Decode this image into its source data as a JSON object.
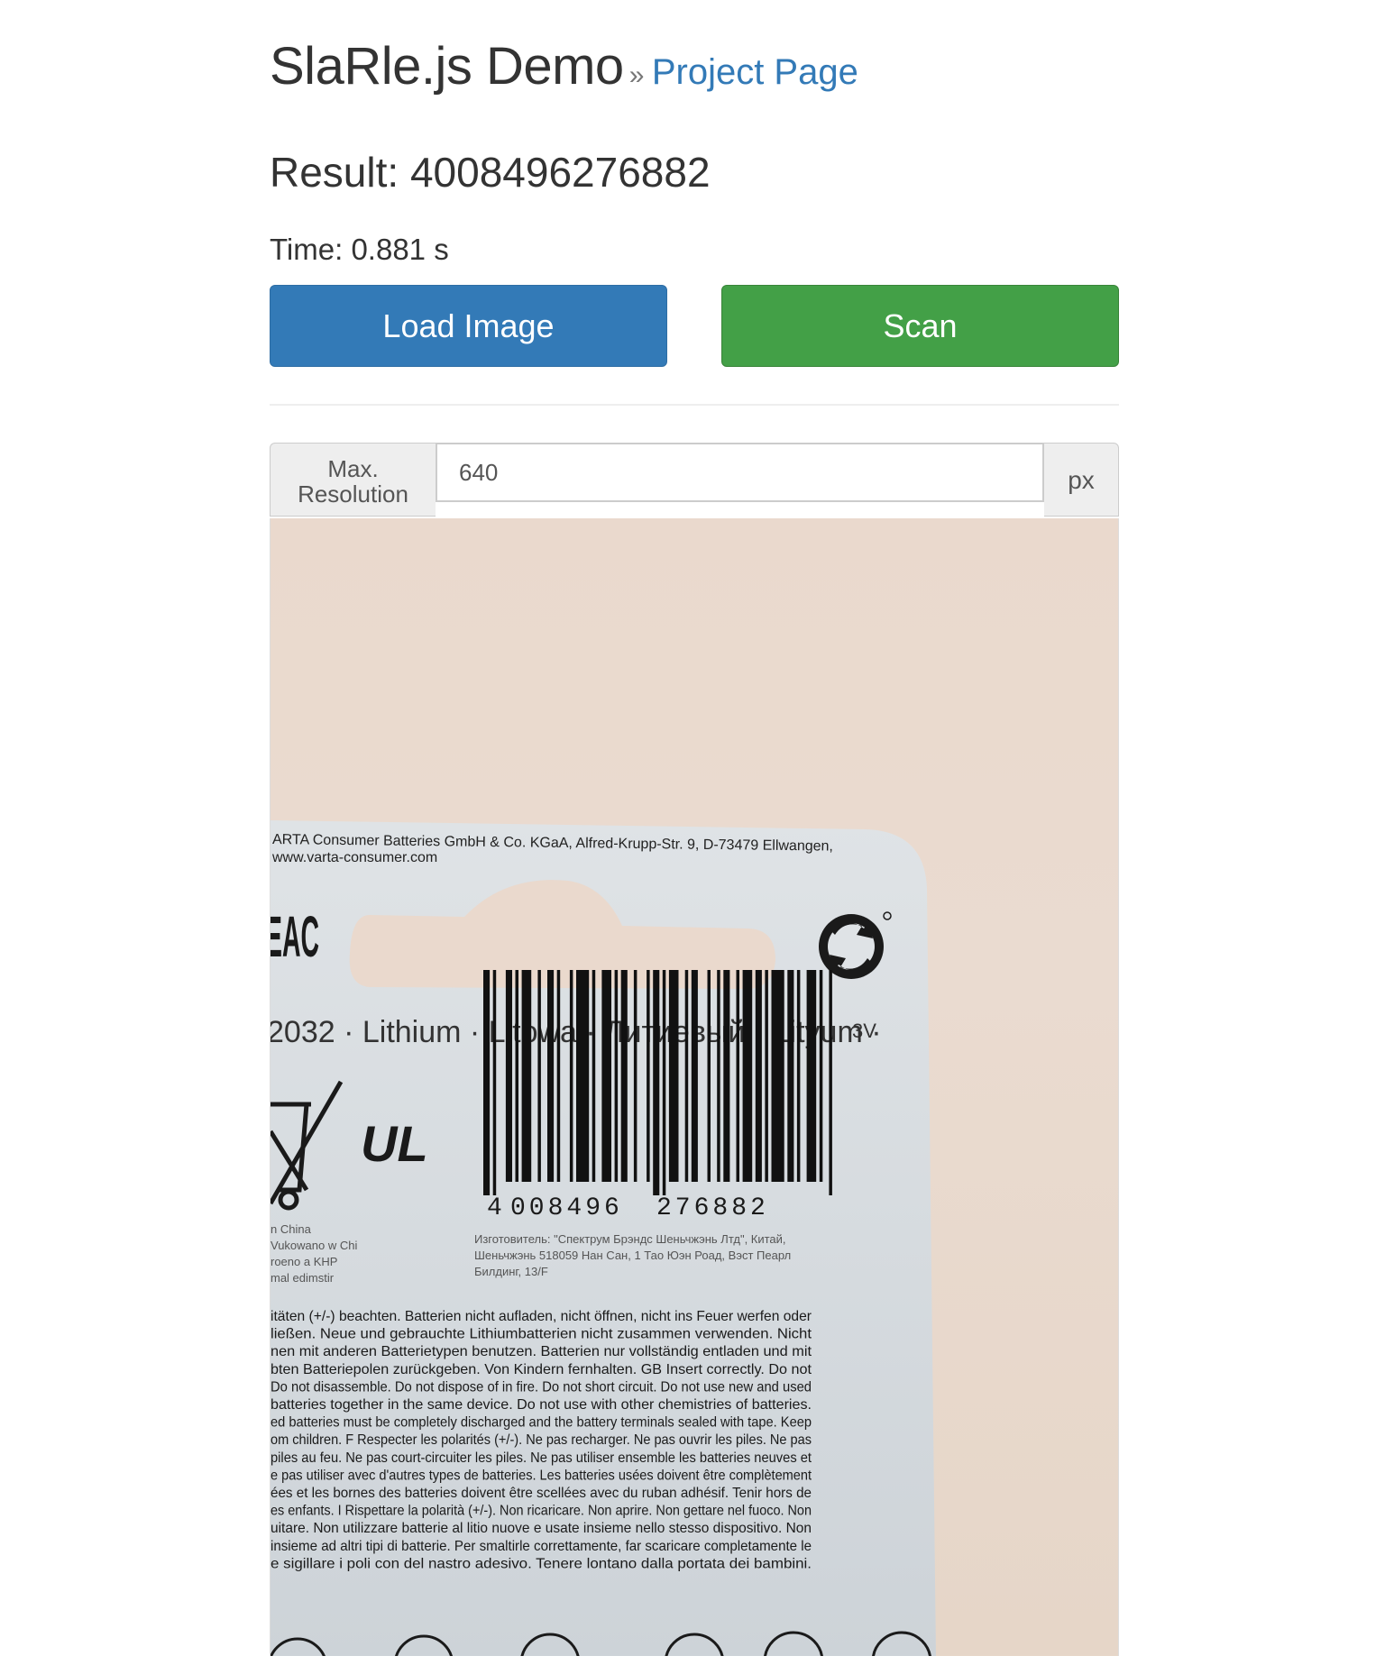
{
  "header": {
    "title": "SlaRle.js Demo",
    "separator": "»",
    "project_link": "Project Page"
  },
  "result": {
    "label": "Result: 4008496276882"
  },
  "time": {
    "label": "Time: 0.881 s"
  },
  "buttons": {
    "load_label": "Load Image",
    "scan_label": "Scan"
  },
  "resolution": {
    "label_line1": "Max.",
    "label_line2": "Resolution",
    "value": "640",
    "unit": "px"
  },
  "photo": {
    "company_line1": "ARTA Consumer Batteries GmbH & Co. KGaA, Alfred-Krupp-Str. 9, D-73479 Ellwangen,",
    "company_line2": "www.varta-consumer.com",
    "eac": "EAC",
    "product_line": "2032 · Lithium · Litowa · Литиевый · Lityum ·",
    "voltage": "3V",
    "barcode_digits": "4  008496  276882",
    "barcode_first": "4",
    "barcode_group1": "008496",
    "barcode_group2": "276882",
    "ul_mark": "UL",
    "left_small": [
      "n China",
      "Vukowano w Chi",
      "roeno a KHP",
      "mal edimstir"
    ],
    "ru_small": [
      "Изготовитель: \"Спектрум Брэндс Шеньчжэнь Лтд\", Китай,",
      "Шеньчжэнь 518059 Нан Сан, 1 Тао Юэн Роад, Вэст Пеарл",
      "Билдинг, 13/F"
    ],
    "warning_text": [
      "itäten (+/-) beachten. Batterien nicht aufladen, nicht öffnen, nicht ins Feuer werfen oder",
      "ließen. Neue und gebrauchte Lithiumbatterien nicht zusammen verwenden. Nicht",
      "nen mit anderen Batterietypen benutzen. Batterien nur vollständig entladen und mit",
      "bten Batteriepolen zurückgeben. Von Kindern fernhalten. GB Insert correctly. Do not",
      "Do not disassemble. Do not dispose of in fire. Do not short circuit. Do not use new and used",
      "batteries together in the same device. Do not use with other chemistries of batteries.",
      "ed batteries must be completely discharged and the battery terminals sealed with tape. Keep",
      "om children. F Respecter les polarités (+/-). Ne pas recharger. Ne pas ouvrir les piles. Ne pas",
      "piles au feu. Ne pas court-circuiter les piles. Ne pas utiliser ensemble les batteries neuves et",
      "e pas utiliser avec d'autres types de batteries. Les batteries usées doivent être complètement",
      "ées et les bornes des batteries doivent être scellées avec du ruban adhésif. Tenir hors de",
      "es enfants. I Rispettare la polarità (+/-). Non ricaricare. Non aprire. Non gettare nel fuoco. Non",
      "uitare. Non utilizzare batterie al litio nuove e usate insieme nello stesso dispositivo. Non",
      "insieme ad altri tipi di batterie. Per smaltirle correttamente, far scaricare completamente le",
      "e sigillare i poli con del nastro adesivo. Tenere lontano dalla portata dei bambini."
    ]
  }
}
